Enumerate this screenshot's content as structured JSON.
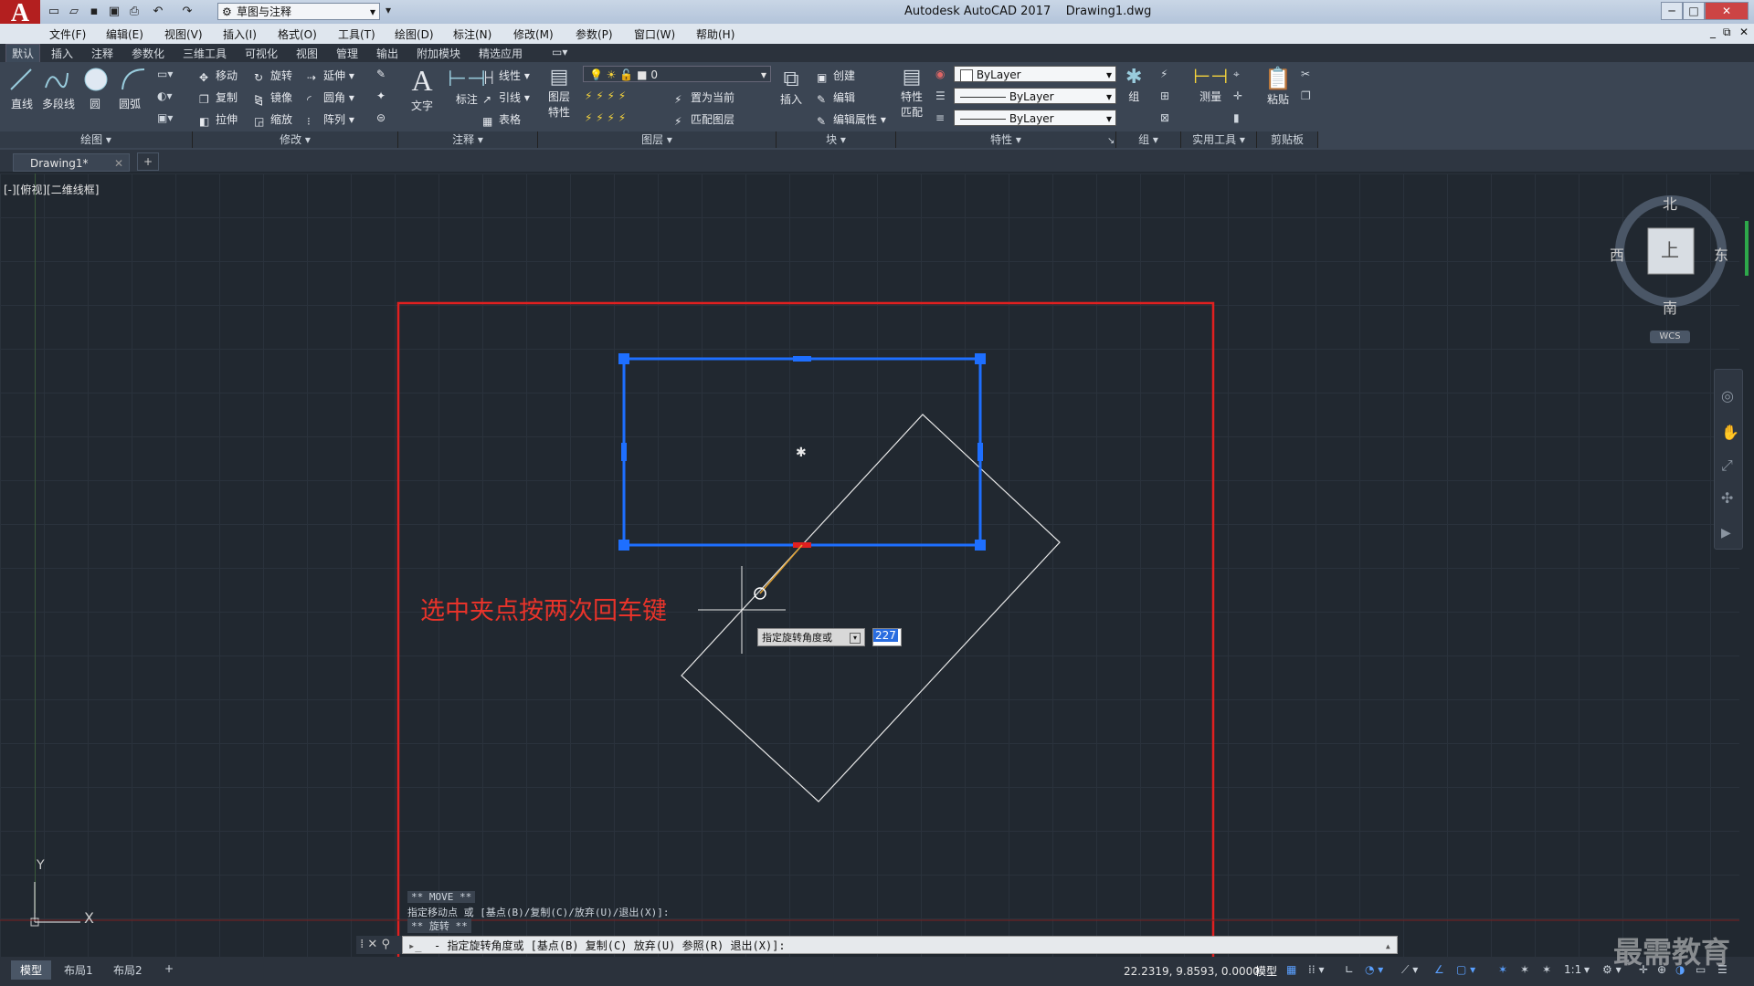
{
  "app": {
    "title": "Autodesk AutoCAD 2017",
    "file": "Drawing1.dwg",
    "logo_letter": "A",
    "workspace": "草图与注释",
    "window_controls": [
      "─",
      "□",
      "✕"
    ],
    "doc_controls": [
      "_",
      "⧉",
      "✕"
    ]
  },
  "menus": [
    "文件(F)",
    "编辑(E)",
    "视图(V)",
    "插入(I)",
    "格式(O)",
    "工具(T)",
    "绘图(D)",
    "标注(N)",
    "修改(M)",
    "参数(P)",
    "窗口(W)",
    "帮助(H)"
  ],
  "ribbon_tabs": [
    "默认",
    "插入",
    "注释",
    "参数化",
    "三维工具",
    "可视化",
    "视图",
    "管理",
    "输出",
    "附加模块",
    "精选应用"
  ],
  "ribbon": {
    "draw": {
      "line": "直线",
      "polyline": "多段线",
      "circle": "圆",
      "arc": "圆弧",
      "panel": "绘图"
    },
    "modify": {
      "move": "移动",
      "rotate": "旋转",
      "extend": "延伸",
      "copy": "复制",
      "mirror": "镜像",
      "fillet": "圆角",
      "stretch": "拉伸",
      "scale": "缩放",
      "array": "阵列",
      "panel": "修改"
    },
    "annotation": {
      "text": "文字",
      "dimension": "标注",
      "linear": "线性",
      "leader": "引线",
      "table": "表格",
      "panel": "注释"
    },
    "layers": {
      "properties_l1": "图层",
      "properties_l2": "特性",
      "current_layer": "0",
      "set_current": "置为当前",
      "match_layer": "匹配图层",
      "panel": "图层"
    },
    "block": {
      "insert": "插入",
      "create": "创建",
      "edit": "编辑",
      "edit_attr": "编辑属性",
      "panel": "块"
    },
    "properties": {
      "match_l1": "特性",
      "match_l2": "匹配",
      "color": "ByLayer",
      "linetype": "ByLayer",
      "lineweight": "ByLayer",
      "panel": "特性"
    },
    "groups": {
      "group": "组",
      "panel": "组"
    },
    "utilities": {
      "measure": "测量",
      "panel": "实用工具"
    },
    "clipboard": {
      "paste": "粘贴",
      "panel": "剪贴板"
    }
  },
  "doc_tab": {
    "name": "Drawing1*",
    "close": "✕",
    "new": "+"
  },
  "viewport": {
    "label": "[-][俯视][二维线框]",
    "annotation": "选中夹点按两次回车键",
    "tooltip": "指定旋转角度或",
    "angle_value": "227",
    "center_mark": "✱",
    "axis_x": "X",
    "axis_y": "Y"
  },
  "viewcube": {
    "north": "北",
    "south": "南",
    "east": "东",
    "west": "西",
    "face": "上",
    "wcs": "WCS"
  },
  "command": {
    "history": [
      "** MOVE **",
      "指定移动点 或 [基点(B)/复制(C)/放弃(U)/退出(X)]:",
      "** 旋转 **"
    ],
    "prompt": "- 指定旋转角度或 [基点(B) 复制(C) 放弃(U) 参照(R) 退出(X)]:"
  },
  "layout_tabs": [
    "模型",
    "布局1",
    "布局2"
  ],
  "status": {
    "coords": "22.2319, 9.8593, 0.0000",
    "mode": "模型",
    "scale": "1:1"
  },
  "watermark": "最需教育",
  "colors": {
    "grip": "#1e6fff",
    "selection": "#1e6fff",
    "annotation": "#e8332a",
    "red_frame": "#e02020"
  }
}
